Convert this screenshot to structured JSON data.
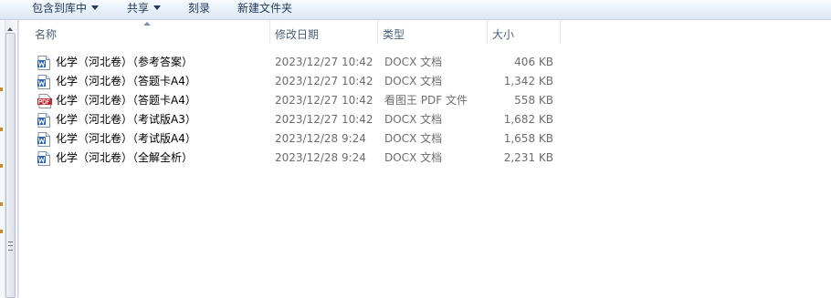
{
  "toolbar": {
    "items": [
      {
        "label": "包含到库中",
        "has_dropdown": true
      },
      {
        "label": "共享",
        "has_dropdown": true
      },
      {
        "label": "刻录",
        "has_dropdown": false
      },
      {
        "label": "新建文件夹",
        "has_dropdown": false
      }
    ]
  },
  "columns": {
    "name": "名称",
    "date": "修改日期",
    "type": "类型",
    "size": "大小"
  },
  "files": [
    {
      "name": "化学（河北卷）（参考答案）",
      "date": "2023/12/27 10:42",
      "type": "DOCX 文档",
      "size": "406 KB",
      "icon": "word-doc-icon"
    },
    {
      "name": "化学（河北卷）（答题卡A4）",
      "date": "2023/12/27 10:42",
      "type": "DOCX 文档",
      "size": "1,342 KB",
      "icon": "word-doc-icon"
    },
    {
      "name": "化学（河北卷）（答题卡A4）",
      "date": "2023/12/27 10:42",
      "type": "看图王 PDF 文件",
      "size": "558 KB",
      "icon": "pdf-icon"
    },
    {
      "name": "化学（河北卷）（考试版A3）",
      "date": "2023/12/27 10:42",
      "type": "DOCX 文档",
      "size": "1,682 KB",
      "icon": "word-doc-icon"
    },
    {
      "name": "化学（河北卷）（考试版A4）",
      "date": "2023/12/28 9:24",
      "type": "DOCX 文档",
      "size": "1,658 KB",
      "icon": "word-doc-icon"
    },
    {
      "name": "化学（河北卷）（全解全析）",
      "date": "2023/12/28 9:24",
      "type": "DOCX 文档",
      "size": "2,231 KB",
      "icon": "word-doc-icon"
    }
  ],
  "colors": {
    "toolbar_text": "#1e395b",
    "header_text": "#4c607a",
    "secondary_text": "#6d6d6d",
    "word_icon_blue": "#2b63b8",
    "pdf_icon_red": "#c4262e"
  }
}
